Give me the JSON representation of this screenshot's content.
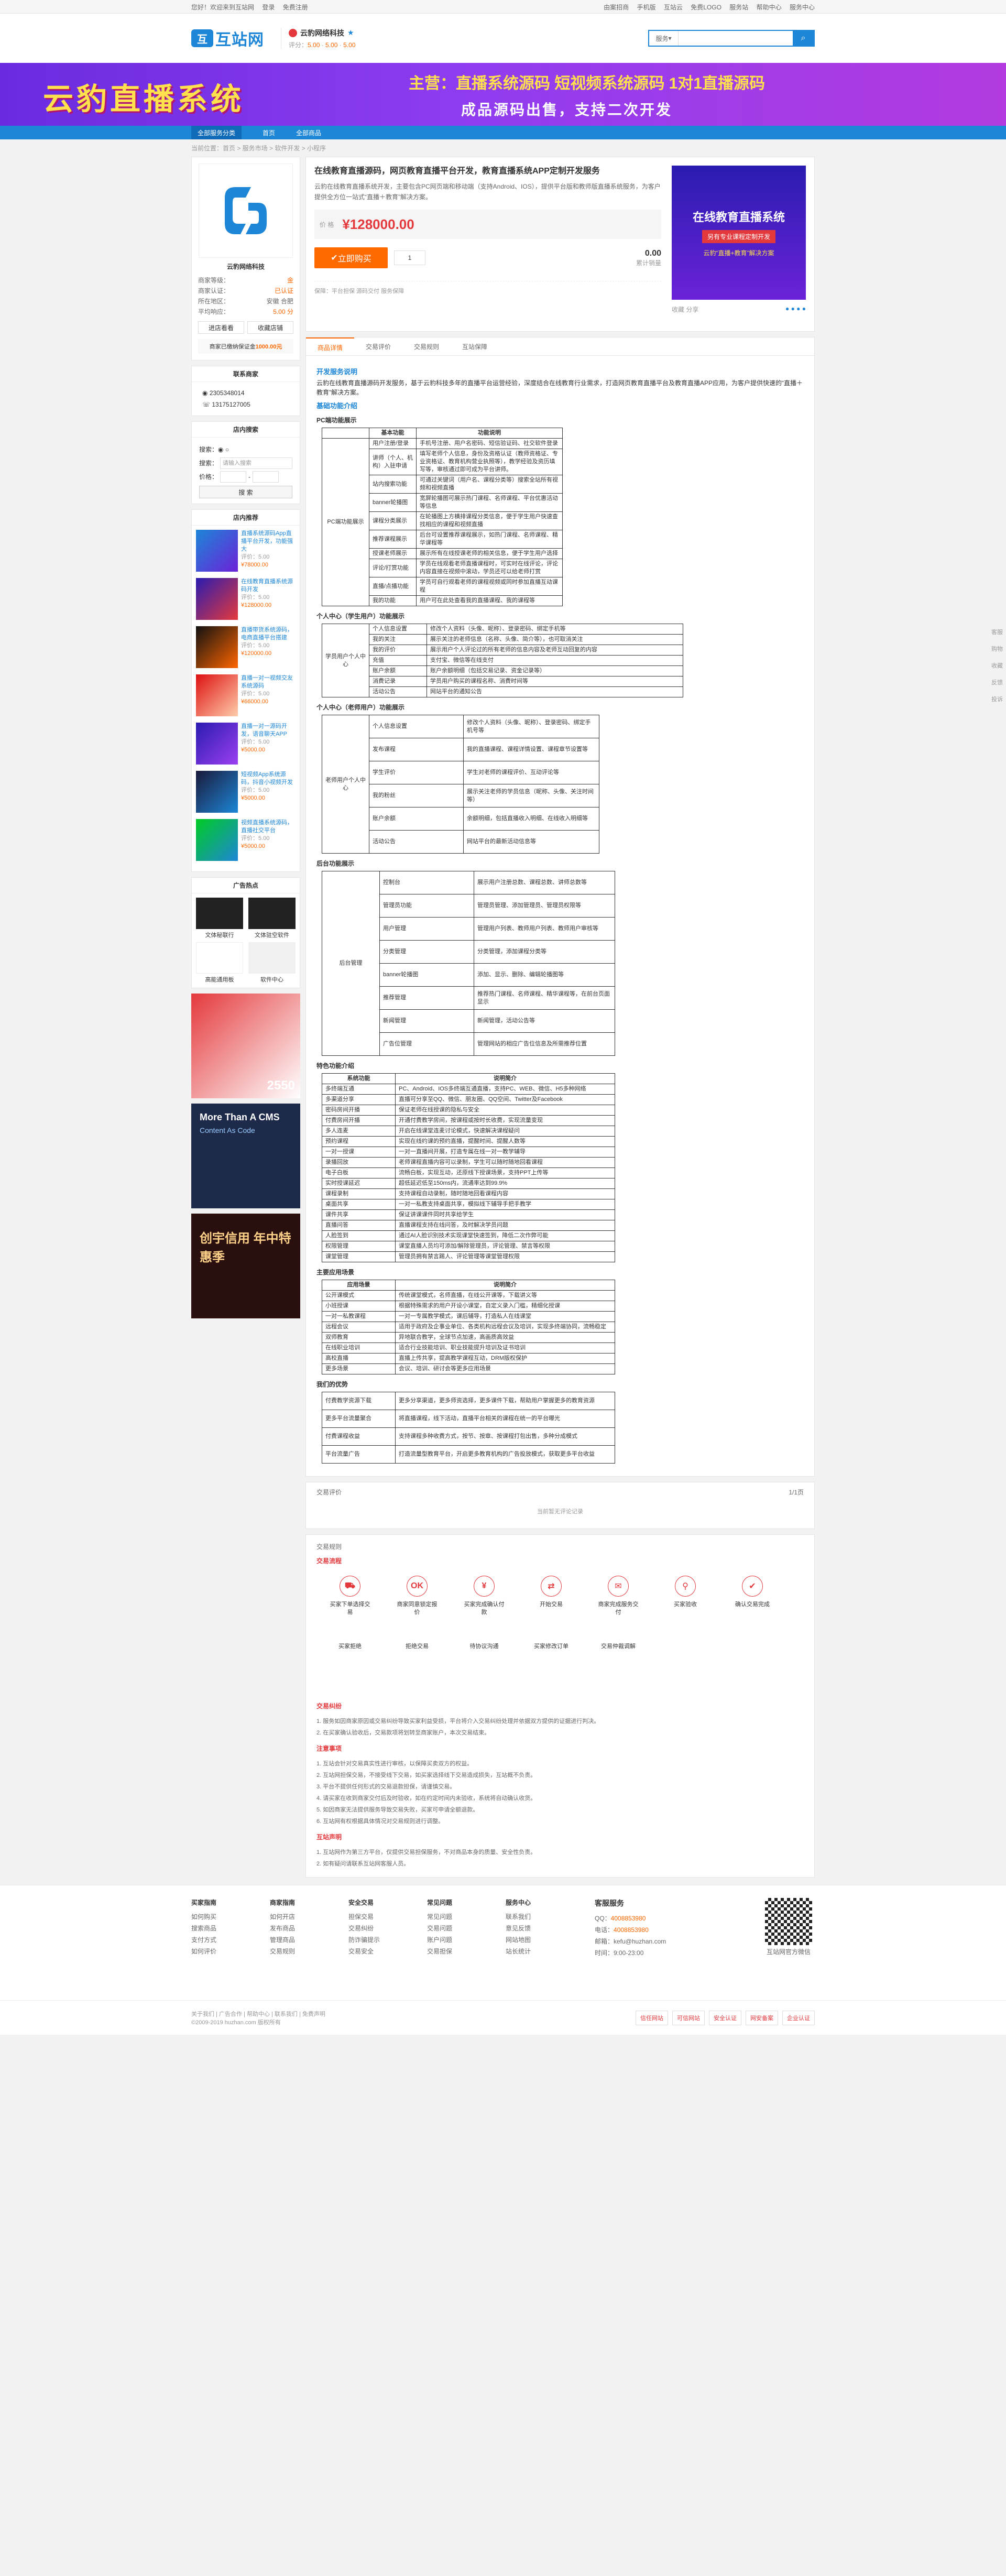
{
  "topbar": {
    "greeting": "您好！欢迎来到互站网",
    "login": "登录",
    "register": "免费注册",
    "links": [
      "由案招商",
      "手机版",
      "互站云",
      "免费LOGO",
      "服务站",
      "帮助中心",
      "服务中心"
    ]
  },
  "search": {
    "scope": "服务",
    "placeholder": ""
  },
  "logo": {
    "name": "互站网"
  },
  "shop": {
    "name": "云豹网络科技",
    "score_label": "评分：",
    "s1": "5.00",
    "s2": "5.00",
    "s3": "5.00"
  },
  "banner": {
    "title": "云豹直播系统",
    "sub1": "主营：直播系统源码  短视频系统源码  1对1直播源码",
    "sub2": "成品源码出售，支持二次开发"
  },
  "nav": {
    "cat": "全部服务分类",
    "items": [
      "首页",
      "全部商品"
    ]
  },
  "crumb": "当前位置：首页 > 服务市场 > 软件开发 > 小程序",
  "side": {
    "shopname": "云豹网络科技",
    "rows": [
      {
        "k": "商家等级：",
        "v": "金"
      },
      {
        "k": "商家认证：",
        "v": "已认证"
      },
      {
        "k": "所在地区：",
        "v": "安徽 合肥"
      },
      {
        "k": "平均响应：",
        "v": "5.00 分"
      }
    ],
    "btn1": "进店看看",
    "btn2": "收藏店铺",
    "guarantee": "商家已缴纳保证金",
    "guarantee_amt": "1000.00元",
    "contact_title": "联系商家",
    "qq": "2305348014",
    "phone": "13175127005",
    "search_title": "店内搜索",
    "search_lbl": "搜索：",
    "kw": "请输入搜索",
    "price_lbl": "价格：",
    "search_btn": "搜 索",
    "hot_title": "店内推荐",
    "hot": [
      {
        "t": "直播系统源码App直播平台开发，功能强大",
        "p": "评价：5.00",
        "pr": "¥78000.00"
      },
      {
        "t": "在线教育直播系统源码开发",
        "p": "评价：5.00",
        "pr": "¥128000.00"
      },
      {
        "t": "直播带货系统源码，电商直播平台搭建",
        "p": "评价：5.00",
        "pr": "¥120000.00"
      },
      {
        "t": "直播一对一视频交友系统源码",
        "p": "评价：5.00",
        "pr": "¥66000.00"
      },
      {
        "t": "直播一对一源码开发，语音聊天APP",
        "p": "评价：5.00",
        "pr": "¥5000.00"
      },
      {
        "t": "短视频App系统源码，抖音小视频开发",
        "p": "评价：5.00",
        "pr": "¥5000.00"
      },
      {
        "t": "视频直播系统源码，直播社交平台",
        "p": "评价：5.00",
        "pr": "¥5000.00"
      }
    ],
    "ads_title": "广告热点",
    "ads": [
      "文体秘联行",
      "文体驻空软件",
      "高能通用板",
      "软件中心"
    ],
    "ad1": "2550",
    "ad2_t": "More Than A CMS",
    "ad2_s": "Content As Code",
    "ad3": "创宇信用 年中特惠季"
  },
  "product": {
    "title": "在线教育直播源码，网页教育直播平台开发，教育直播系统APP定制开发服务",
    "desc": "云豹在线教育直播系统开发，主要包含PC网页端和移动端（支持Android、IOS），提供平台版和教师版直播系统服务，为客户提供全方位一站式“直播＋教育”解决方案。",
    "price_label": "价 格",
    "price": "¥128000.00",
    "buy": "立即购买",
    "qty": "1",
    "sales": "0.00",
    "sales_lbl": "累计销量",
    "foot": "保障：平台担保  源码交付  服务保障",
    "img_t1": "在线教育直播系统",
    "img_t2": "另有专业课程定制开发",
    "img_t3": "云豹“直播+教育”解决方案",
    "ops": "收藏  分享"
  },
  "tabs": [
    "商品详情",
    "交易评价",
    "交易规则",
    "互站保障"
  ],
  "detail": {
    "h1": "开发服务说明",
    "p1": "云豹在线教育直播源码开发服务，基于云豹科技多年的直播平台运营经验，深度结合在线教育行业需求，打造网页教育直播平台及教育直播APP应用，为客户提供快速的“直播＋教育”解决方案。",
    "h2": "基础功能介绍",
    "sec_pc": "PC端功能展示",
    "pc_cols": [
      "功能分区",
      "基本功能",
      "功能说明"
    ],
    "pc_group": "PC端功能展示",
    "pc_rows": [
      [
        "用户注册/登录",
        "手机号注册、用户名密码、短信验证码、社交软件登录"
      ],
      [
        "讲师（个人、机构）入驻申请",
        "填写老师个人信息，身份及资格认证（教师资格证、专业资格证、教育机构营业执照等），教学经验及资历填写等，审核通过即可成为平台讲师。"
      ],
      [
        "站内搜索功能",
        "可通过关键词（用户名、课程分类等）搜索全站所有视频和视频直播"
      ],
      [
        "banner轮播图",
        "宽屏轮播图可展示热门课程、名师课程、平台优惠活动等信息"
      ],
      [
        "课程分类展示",
        "在轮播图上方横排课程分类信息，便于学生用户快速查找相应的课程和视频直播"
      ],
      [
        "推荐课程展示",
        "后台可设置推荐课程展示，如热门课程、名师课程、精华课程等"
      ],
      [
        "授课老师展示",
        "展示所有在线授课老师的相关信息，便于学生用户选择"
      ],
      [
        "评论/打赏功能",
        "学员在线观看老师直播课程时，可实时在线评论，评论内容直接在视频中滚动，学员还可以给老师打赏"
      ],
      [
        "直播/点播功能",
        "学员可自行观看老师的课程视频或同时参加直播互动课程"
      ],
      [
        "我的功能",
        "用户可在此处查看我的直播课程、我的课程等"
      ]
    ],
    "sec_stu": "个人中心（学生用户）功能展示",
    "stu_group": "学员用户个人中心",
    "stu_rows": [
      [
        "个人信息设置",
        "修改个人资料（头像、昵称）、登录密码、绑定手机等"
      ],
      [
        "我的关注",
        "展示关注的老师信息（名称、头像、简介等），也可取消关注"
      ],
      [
        "我的评价",
        "展示用户个人评论过的所有老师的信息内容及老师互动回复的内容"
      ],
      [
        "充值",
        "支付宝、微信等在线支付"
      ],
      [
        "账户余额",
        "账户余额明细（包括交易记录、资金记录等）"
      ],
      [
        "消费记录",
        "学员用户购买的课程名称、消费时间等"
      ],
      [
        "活动公告",
        "网站平台的通知公告"
      ]
    ],
    "sec_tea": "个人中心（老师用户）功能展示",
    "tea_group": "老师用户个人中心",
    "tea_rows": [
      [
        "个人信息设置",
        "修改个人资料（头像、昵称）、登录密码、绑定手机号等"
      ],
      [
        "发布课程",
        "我的直播课程、课程详情设置、课程章节设置等"
      ],
      [
        "学生评价",
        "学生对老师的课程评价、互动评论等"
      ],
      [
        "我的粉丝",
        "展示关注老师的学员信息（昵称、头像、关注时间等）"
      ],
      [
        "账户余额",
        "余额明细，包括直播收入明细、在线收入明细等"
      ],
      [
        "活动公告",
        "网站平台的最新活动信息等"
      ]
    ],
    "sec_adm": "后台功能展示",
    "adm_group": "后台管理",
    "adm_rows": [
      [
        "控制台",
        "展示用户注册总数、课程总数、讲师总数等"
      ],
      [
        "管理员功能",
        "管理员管理、添加管理员、管理员权限等"
      ],
      [
        "用户管理",
        "管理用户列表、教师用户列表、教师用户审核等"
      ],
      [
        "分类管理",
        "分类管理，添加课程分类等"
      ],
      [
        "banner轮播图",
        "添加、显示、删除、编辑轮播图等"
      ],
      [
        "推荐管理",
        "推荐热门课程、名师课程、精华课程等，在前台页面显示"
      ],
      [
        "新闻管理",
        "新闻管理，活动公告等"
      ],
      [
        "广告位管理",
        "管理网站的相应广告位信息及所需推荐位置"
      ]
    ],
    "sec_spec": "特色功能介绍",
    "spec_cols": [
      "系统功能",
      "说明简介"
    ],
    "spec_rows": [
      [
        "多终端互通",
        "PC、Android、IOS多终端互通直播，支持PC、WEB、微信、H5多种网络"
      ],
      [
        "多渠道分享",
        "直播可分享至QQ、微信、朋友圈、QQ空间、Twitter及Facebook"
      ],
      [
        "密码房间开播",
        "保证老师在线授课的隐私与安全"
      ],
      [
        "付费房间开播",
        "开通付费教学房间，按课程或按时长收费，实现流量变现"
      ],
      [
        "多人连麦",
        "开启在线课堂连麦讨论模式，快速解决课程疑问"
      ],
      [
        "预约课程",
        "实现在线约课的预约直播，提醒时间、提醒人数等"
      ],
      [
        "一对一授课",
        "一对一直播间开展，打造专属在线一对一教学辅导"
      ],
      [
        "录播回放",
        "老师课程直播内容可以录制，学生可以随时随地回看课程"
      ],
      [
        "电子白板",
        "流畅白板，实现互动，还原线下授课场景，支持PPT上传等"
      ],
      [
        "实时授课延迟",
        "超低延迟低至150ms内，流通率达到99.9%"
      ],
      [
        "课程录制",
        "支持课程自动录制，随时随地回看课程内容"
      ],
      [
        "桌面共享",
        "一对一私教支持桌面共享，模拟线下辅导手把手教学"
      ],
      [
        "课件共享",
        "保证讲课课件同时共享给学生"
      ],
      [
        "直播问答",
        "直播课程支持在线问答，及时解决学员问题"
      ],
      [
        "人脸签到",
        "通过AI人脸识别技术实现课堂快速签到，降低二次作弊可能"
      ],
      [
        "权限管理",
        "课堂直播人员均可添加/解除管理员，评论管理、禁言等权限"
      ],
      [
        "课堂管理",
        "管理员拥有禁言踢人、评论管理等课堂管理权限"
      ]
    ],
    "sec_scene": "主要应用场景",
    "scene_cols": [
      "应用场景",
      "说明简介"
    ],
    "scene_rows": [
      [
        "公开课模式",
        "传统课堂模式，名师直播，在线公开课等，下载讲义等"
      ],
      [
        "小班授课",
        "根据特殊需求的用户开设小课堂，自定义录入门槛，精细化授课"
      ],
      [
        "一对一私教课程",
        "一对一专属教学模式，课后辅导，打造私人在线课堂"
      ],
      [
        "远程会议",
        "适用于政府及企事业单位、各类机构远程会议及培训，实现多终端协同，流畅稳定"
      ],
      [
        "双师教育",
        "异地联合教学，全球节点加速，高画质高效益"
      ],
      [
        "在线职业培训",
        "适合行业技能培训、职业技能提升培训及证书培训"
      ],
      [
        "高校直播",
        "直播上传共享，提高教学课程互动，DRM版权保护"
      ],
      [
        "更多场景",
        "会议、培训、研讨会等更多应用场景"
      ]
    ],
    "sec_adv": "我们的优势",
    "adv_rows": [
      [
        "付费教学资源下载",
        "更多分享渠道，更多师资选择，更多课件下载，帮助用户掌握更多的教育资源"
      ],
      [
        "更多平台流量聚合",
        "将直播课程，线下活动，直播平台相关的课程在统一的平台曝光"
      ],
      [
        "付费课程收益",
        "支持课程多种收费方式，按节、按章、按课程打包出售，多种分成模式"
      ],
      [
        "平台流量广告",
        "打造流量型教育平台，开启更多教育机构的广告投放模式，获取更多平台收益"
      ]
    ]
  },
  "comments": {
    "title": "交易评价",
    "pager": "1/1页",
    "empty": "当前暂无评论记录"
  },
  "rules": {
    "title": "交易规则",
    "flow_title": "交易流程",
    "steps": [
      "买家下单选择交易",
      "商家同意锁定报价",
      "买家完成确认付款",
      "开始交易",
      "商家完成服务交付",
      "买家验收",
      "确认交易完成",
      "买家拒绝",
      "拒绝交易",
      "待协议沟通",
      "买家修改订单",
      "交易仲裁调解"
    ],
    "notice_title": "交易纠纷",
    "notice": [
      "1. 服务如因商家原因或交易纠纷导致买家利益受损，平台将介入交易纠纷处理并依据双方提供的证据进行判决。",
      "2. 在买家确认验收后，交易款项将划转至商家账户，本次交易结束。"
    ],
    "note_title": "注意事项",
    "notes": [
      "1. 互站会针对交易真实性进行审核，以保障买卖双方的权益。",
      "2. 互站网担保交易，不接受线下交易，如买家选择线下交易造成损失，互站概不负责。",
      "3. 平台不提供任何形式的交易退款担保，请谨慎交易。",
      "4. 请买家在收到商家交付后及时验收，如在约定时间内未验收，系统将自动确认收货。",
      "5. 如因商家无法提供服务导致交易失败，买家可申请全额退款。",
      "6. 互站网有权根据具体情况对交易规则进行调整。"
    ],
    "dec_title": "互站声明",
    "decs": [
      "1. 互站网作为第三方平台，仅提供交易担保服务，不对商品本身的质量、安全性负责。",
      "2. 如有疑问请联系互站网客服人员。"
    ]
  },
  "footer": {
    "cols": [
      {
        "h": "买家指南",
        "i": [
          "如何购买",
          "搜索商品",
          "支付方式",
          "如何评价"
        ]
      },
      {
        "h": "商家指南",
        "i": [
          "如何开店",
          "发布商品",
          "管理商品",
          "交易规则"
        ]
      },
      {
        "h": "安全交易",
        "i": [
          "担保交易",
          "交易纠纷",
          "防诈骗提示",
          "交易安全"
        ]
      },
      {
        "h": "常见问题",
        "i": [
          "常见问题",
          "交易问题",
          "账户问题",
          "交易担保"
        ]
      },
      {
        "h": "服务中心",
        "i": [
          "联系我们",
          "意见反馈",
          "网站地图",
          "站长统计"
        ]
      }
    ],
    "serv_title": "客服服务",
    "tel": "4008853980",
    "tel_lbl": "电话：",
    "qq_lbl": "QQ：",
    "qq": "4008853980",
    "email": "邮箱：kefu@huzhan.com",
    "time": "时间：9:00-23:00",
    "qr_lbl": "互站网官方微信",
    "copy1": "关于我们 | 广告合作 | 帮助中心 | 联系我们 | 免费声明",
    "copy2": "©2009-2019 huzhan.com 版权所有",
    "badges": [
      "信任网站",
      "可信网站",
      "安全认证",
      "网安备案",
      "企业认证"
    ]
  },
  "rbar": [
    "客服",
    "购物",
    "收藏",
    "反馈",
    "投诉"
  ]
}
